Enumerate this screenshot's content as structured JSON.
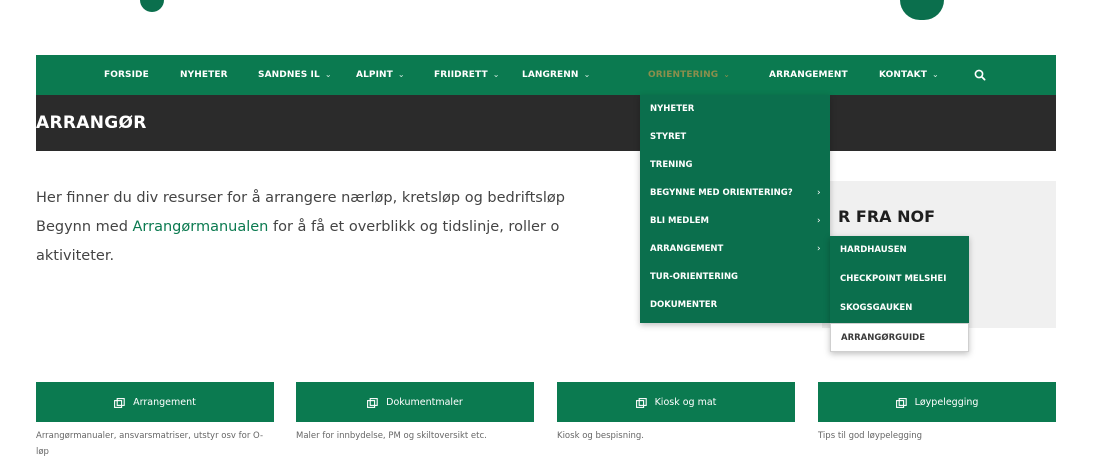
{
  "nav": {
    "items": [
      {
        "label": "FORSIDE",
        "dropdown": false
      },
      {
        "label": "NYHETER",
        "dropdown": false
      },
      {
        "label": "SANDNES IL",
        "dropdown": true
      },
      {
        "label": "ALPINT",
        "dropdown": true
      },
      {
        "label": "FRIIDRETT",
        "dropdown": true
      },
      {
        "label": "LANGRENN",
        "dropdown": true
      },
      {
        "label": "ORIENTERING",
        "dropdown": true,
        "active": true
      },
      {
        "label": "ARRANGEMENT",
        "dropdown": false
      },
      {
        "label": "KONTAKT",
        "dropdown": true
      }
    ],
    "search_icon": "search-icon",
    "chevron": "⌄"
  },
  "header": {
    "title": "ARRANGØR"
  },
  "intro": {
    "line1": "Her finner du div resurser for å arrangere nærløp, kretsløp og bedriftsløp",
    "line2_before": "Begynn med ",
    "line2_link": "Arrangørmanualen",
    "line2_after": " for å få et overblikk og tidslinje, roller o",
    "line3": "aktiviteter."
  },
  "sidebox": {
    "title": "R FRA NOF"
  },
  "dropdown": {
    "items": [
      {
        "label": "NYHETER",
        "submenu": false
      },
      {
        "label": "STYRET",
        "submenu": false
      },
      {
        "label": "TRENING",
        "submenu": false
      },
      {
        "label": "BEGYNNE MED ORIENTERING?",
        "submenu": true
      },
      {
        "label": "BLI MEDLEM",
        "submenu": true
      },
      {
        "label": "ARRANGEMENT",
        "submenu": true
      },
      {
        "label": "TUR-ORIENTERING",
        "submenu": false
      },
      {
        "label": "DOKUMENTER",
        "submenu": false
      }
    ],
    "arrow": "›"
  },
  "subdropdown": {
    "items": [
      {
        "label": "HARDHAUSEN"
      },
      {
        "label": "CHECKPOINT MELSHEI"
      },
      {
        "label": "SKOGSGAUKEN"
      },
      {
        "label": "ARRANGØRGUIDE",
        "active": true
      }
    ]
  },
  "cards": [
    {
      "label": "Arrangement",
      "icon": "external-link-icon",
      "desc": "Arrangørmanualer, ansvarsmatriser, utstyr osv for O-løp"
    },
    {
      "label": "Dokumentmaler",
      "icon": "external-link-icon",
      "desc": "Maler for innbydelse, PM og skiltoversikt etc."
    },
    {
      "label": "Kiosk og mat",
      "icon": "external-link-icon",
      "desc": "Kiosk og bespisning."
    },
    {
      "label": "Løypelegging",
      "icon": "external-link-icon",
      "desc": "Tips til god løypelegging"
    }
  ],
  "colors": {
    "brand_green": "#0b7a50",
    "menu_green": "#0b6f4d",
    "header_dark": "#2b2b2b",
    "active_orange": "#f4a04a"
  }
}
